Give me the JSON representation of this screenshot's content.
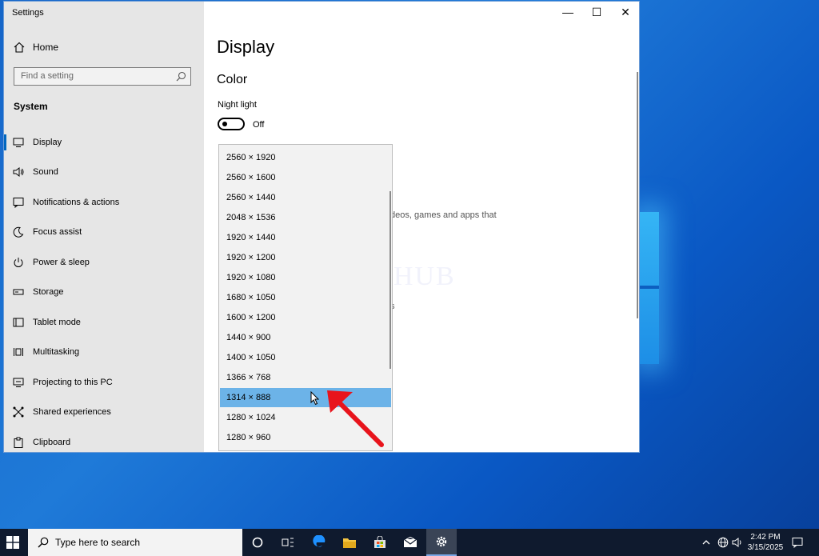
{
  "window": {
    "title": "Settings",
    "minimize": "—",
    "maximize": "☐",
    "close": "✕"
  },
  "sidebar": {
    "home": "Home",
    "search_placeholder": "Find a setting",
    "section": "System",
    "items": [
      {
        "label": "Display",
        "icon": "monitor-icon"
      },
      {
        "label": "Sound",
        "icon": "speaker-icon"
      },
      {
        "label": "Notifications & actions",
        "icon": "notification-icon"
      },
      {
        "label": "Focus assist",
        "icon": "moon-icon"
      },
      {
        "label": "Power & sleep",
        "icon": "power-icon"
      },
      {
        "label": "Storage",
        "icon": "storage-icon"
      },
      {
        "label": "Tablet mode",
        "icon": "tablet-icon"
      },
      {
        "label": "Multitasking",
        "icon": "multitasking-icon"
      },
      {
        "label": "Projecting to this PC",
        "icon": "projector-icon"
      },
      {
        "label": "Shared experiences",
        "icon": "share-icon"
      },
      {
        "label": "Clipboard",
        "icon": "clipboard-icon"
      }
    ]
  },
  "main": {
    "title": "Display",
    "subtitle": "Color",
    "night_light_label": "Night light",
    "night_light_state": "Off",
    "bg_text": "deos, games and apps that",
    "bg_fragment": "s"
  },
  "watermark": "IT Pros HUB",
  "resolution_dropdown": {
    "options": [
      "2560 × 1920",
      "2560 × 1600",
      "2560 × 1440",
      "2048 × 1536",
      "1920 × 1440",
      "1920 × 1200",
      "1920 × 1080",
      "1680 × 1050",
      "1600 × 1200",
      "1440 × 900",
      "1400 × 1050",
      "1366 × 768",
      "1314 × 888",
      "1280 × 1024",
      "1280 × 960"
    ],
    "selected": "1314 × 888"
  },
  "taskbar": {
    "search_placeholder": "Type here to search",
    "time": "2:42 PM",
    "date": "3/15/2025"
  },
  "colors": {
    "accent": "#0067c0",
    "selection": "#6cb3e8",
    "annotation_arrow": "#e8141c"
  }
}
